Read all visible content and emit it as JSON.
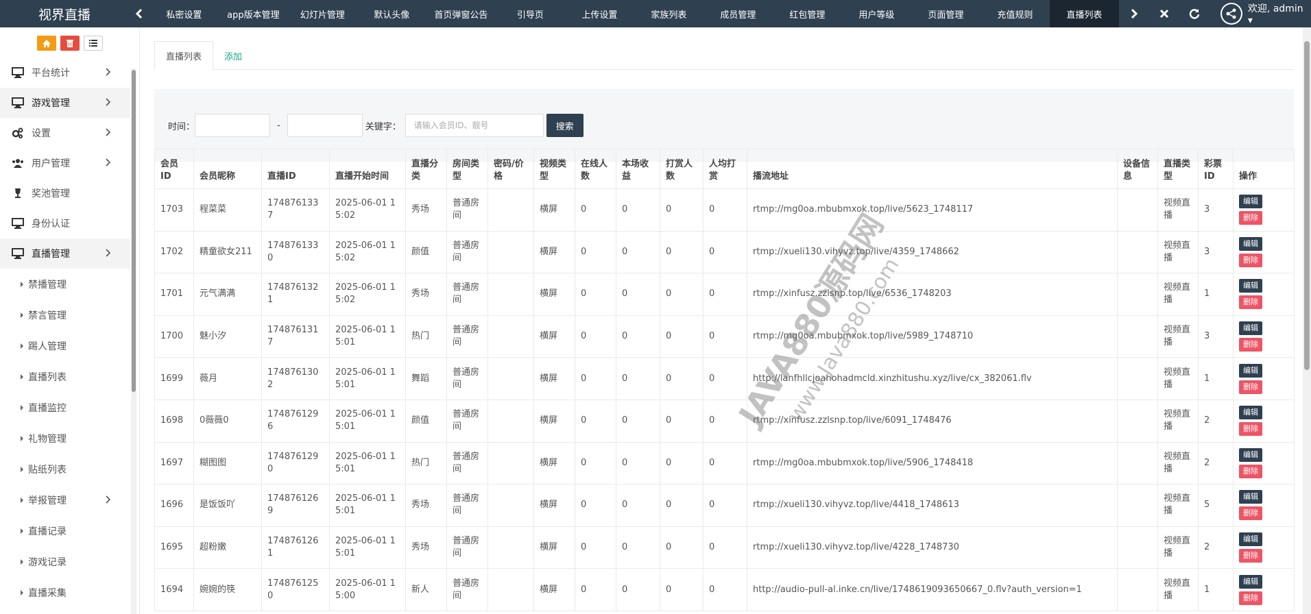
{
  "brand": "视界直播",
  "top_tabs": [
    "私密设置",
    "app版本管理",
    "幻灯片管理",
    "默认头像",
    "首页弹窗公告",
    "引导页",
    "上传设置",
    "家族列表",
    "成员管理",
    "红包管理",
    "用户等级",
    "页面管理",
    "充值规则",
    "直播列表"
  ],
  "active_tab_index": 13,
  "user_greeting": "欢迎, admin ▾",
  "sidebar": {
    "items": [
      {
        "label": "平台统计",
        "icon": "monitor-icon",
        "chevron": true,
        "active": false
      },
      {
        "label": "游戏管理",
        "icon": "monitor-icon",
        "chevron": true,
        "active": true
      },
      {
        "label": "设置",
        "icon": "gears-icon",
        "chevron": true,
        "active": false
      },
      {
        "label": "用户管理",
        "icon": "users-icon",
        "chevron": true,
        "active": false
      },
      {
        "label": "奖池管理",
        "icon": "trophy-icon",
        "chevron": false,
        "active": false
      },
      {
        "label": "身份认证",
        "icon": "monitor-icon",
        "chevron": false,
        "active": false
      },
      {
        "label": "直播管理",
        "icon": "monitor-icon",
        "chevron": true,
        "active": true
      }
    ],
    "subitems": [
      {
        "label": "禁播管理",
        "chevron": false
      },
      {
        "label": "禁言管理",
        "chevron": false
      },
      {
        "label": "踢人管理",
        "chevron": false
      },
      {
        "label": "直播列表",
        "chevron": false
      },
      {
        "label": "直播监控",
        "chevron": false
      },
      {
        "label": "礼物管理",
        "chevron": false
      },
      {
        "label": "贴纸列表",
        "chevron": false
      },
      {
        "label": "举报管理",
        "chevron": true
      },
      {
        "label": "直播记录",
        "chevron": false
      },
      {
        "label": "游戏记录",
        "chevron": false
      },
      {
        "label": "直播采集",
        "chevron": false
      }
    ]
  },
  "content_tabs": {
    "list": "直播列表",
    "add": "添加"
  },
  "search": {
    "time_label": "时间：",
    "dash": "-",
    "keyword_label": "关键字：",
    "keyword_placeholder": "请输入会员ID、靓号",
    "button": "搜索"
  },
  "table": {
    "headers": [
      "会员ID",
      "会员昵称",
      "直播ID",
      "直播开始时间",
      "直播分类",
      "房间类型",
      "密码/价格",
      "视频类型",
      "在线人数",
      "本场收益",
      "打赏人数",
      "人均打赏",
      "播流地址",
      "设备信息",
      "直播类型",
      "彩票ID",
      "操作"
    ],
    "rows": [
      [
        "1703",
        "程菜菜",
        "1748761337",
        "2025-06-01 15:02",
        "秀场",
        "普通房间",
        "",
        "横屏",
        "0",
        "0",
        "0",
        "0",
        "rtmp://mg0oa.mbubmxok.top/live/5623_1748117",
        "",
        "视频直播",
        "3"
      ],
      [
        "1702",
        "精童欲女211",
        "1748761330",
        "2025-06-01 15:02",
        "颜值",
        "普通房间",
        "",
        "横屏",
        "0",
        "0",
        "0",
        "0",
        "rtmp://xueli130.vihyvz.top/live/4359_1748662",
        "",
        "视频直播",
        "3"
      ],
      [
        "1701",
        "元气满满",
        "1748761321",
        "2025-06-01 15:02",
        "秀场",
        "普通房间",
        "",
        "横屏",
        "0",
        "0",
        "0",
        "0",
        "rtmp://xinfusz.zzlsnp.top/live/6536_1748203",
        "",
        "视频直播",
        "1"
      ],
      [
        "1700",
        "魅小汐",
        "1748761317",
        "2025-06-01 15:01",
        "热门",
        "普通房间",
        "",
        "横屏",
        "0",
        "0",
        "0",
        "0",
        "rtmp://mg0oa.mbubmxok.top/live/5989_1748710",
        "",
        "视频直播",
        "3"
      ],
      [
        "1699",
        "薇月",
        "1748761302",
        "2025-06-01 15:01",
        "舞蹈",
        "普通房间",
        "",
        "横屏",
        "0",
        "0",
        "0",
        "0",
        "http://lanfhllcjoahohadmcld.xinzhitushu.xyz/live/cx_382061.flv",
        "",
        "视频直播",
        "1"
      ],
      [
        "1698",
        "0薇薇0",
        "1748761296",
        "2025-06-01 15:01",
        "颜值",
        "普通房间",
        "",
        "横屏",
        "0",
        "0",
        "0",
        "0",
        "rtmp://xinfusz.zzlsnp.top/live/6091_1748476",
        "",
        "视频直播",
        "2"
      ],
      [
        "1697",
        "糊图图",
        "1748761290",
        "2025-06-01 15:01",
        "热门",
        "普通房间",
        "",
        "横屏",
        "0",
        "0",
        "0",
        "0",
        "rtmp://mg0oa.mbubmxok.top/live/5906_1748418",
        "",
        "视频直播",
        "2"
      ],
      [
        "1696",
        "是饭饭吖",
        "1748761269",
        "2025-06-01 15:01",
        "秀场",
        "普通房间",
        "",
        "横屏",
        "0",
        "0",
        "0",
        "0",
        "rtmp://xueli130.vihyvz.top/live/4418_1748613",
        "",
        "视频直播",
        "5"
      ],
      [
        "1695",
        "超粉嫩",
        "1748761261",
        "2025-06-01 15:01",
        "秀场",
        "普通房间",
        "",
        "横屏",
        "0",
        "0",
        "0",
        "0",
        "rtmp://xueli130.vihyvz.top/live/4228_1748730",
        "",
        "视频直播",
        "2"
      ],
      [
        "1694",
        "婉婉的筷",
        "1748761250",
        "2025-06-01 15:00",
        "新人",
        "普通房间",
        "",
        "横屏",
        "0",
        "0",
        "0",
        "0",
        "http://audio-pull-al.inke.cn/live/1748619093650667_0.flv?auth_version=1",
        "",
        "视频直播",
        "1"
      ]
    ],
    "edit_label": "编辑",
    "delete_label": "删除"
  },
  "watermark": {
    "line1": "JAVA880源码网",
    "line2": "www.Java880.com"
  },
  "colors": {
    "topbar": "#2f4050",
    "active_tab": "#1b2631",
    "accent": "#18a689",
    "danger": "#ed5565",
    "orange": "#f39c12"
  }
}
